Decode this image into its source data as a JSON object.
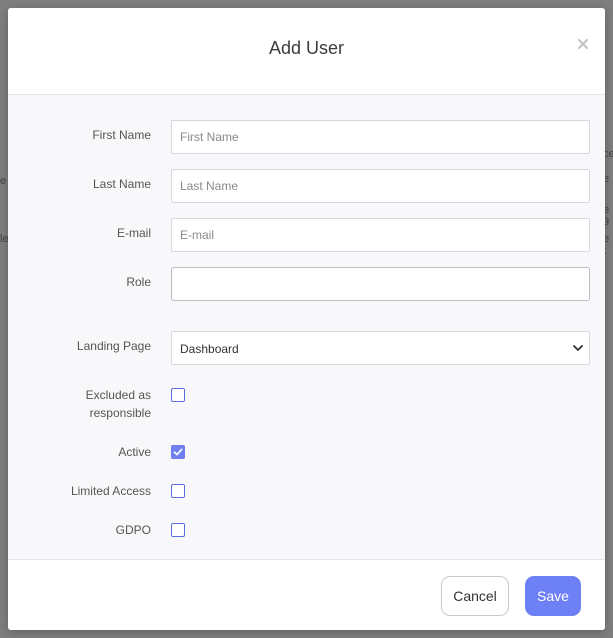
{
  "modal": {
    "title": "Add User",
    "close_icon": "close-icon"
  },
  "form": {
    "first_name": {
      "label": "First Name",
      "placeholder": "First Name",
      "value": ""
    },
    "last_name": {
      "label": "Last Name",
      "placeholder": "Last Name",
      "value": ""
    },
    "email": {
      "label": "E-mail",
      "placeholder": "E-mail",
      "value": ""
    },
    "role": {
      "label": "Role",
      "value": ""
    },
    "landing_page": {
      "label": "Landing Page",
      "selected": "Dashboard"
    },
    "excluded": {
      "label_line1": "Excluded as",
      "label_line2": "responsible",
      "checked": false
    },
    "active": {
      "label": "Active",
      "checked": true
    },
    "limited_access": {
      "label": "Limited Access",
      "checked": false
    },
    "gdpo": {
      "label": "GDPO",
      "checked": false
    }
  },
  "footer": {
    "cancel_label": "Cancel",
    "save_label": "Save"
  },
  "background": {
    "fragments": [
      "ce",
      "e",
      "e",
      "e 9",
      "le",
      "e t"
    ]
  },
  "colors": {
    "accent": "#6e80f5",
    "checkbox_border": "#5b6ee1",
    "overlay": "#7f7f7f"
  }
}
